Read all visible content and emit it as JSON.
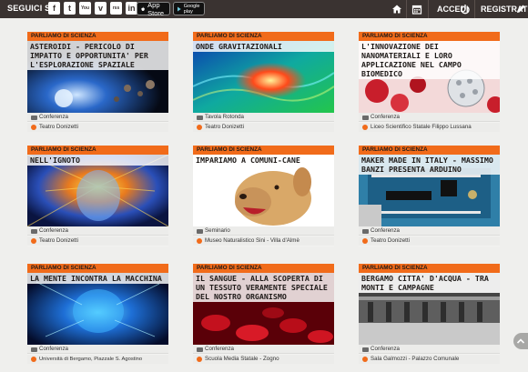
{
  "header": {
    "follow_label": "SEGUICI SU",
    "social": [
      "f",
      "t",
      "You",
      "v",
      "rss",
      "in"
    ],
    "app_store": "App Store",
    "google_play": "Google play",
    "login": "ACCEDI",
    "register": "REGISTRATI"
  },
  "cards": [
    {
      "tag": "PARLIAMO DI SCIENZA",
      "title": "ASTEROIDI - PERICOLO DI IMPATTO E OPPORTUNITA' PER L'ESPLORAZIONE SPAZIALE",
      "type": "Conferenza",
      "place": "Teatro Donizetti"
    },
    {
      "tag": "PARLIAMO DI SCIENZA",
      "title": "ONDE GRAVITAZIONALI",
      "type": "Tavola Rotonda",
      "place": "Teatro Donizetti"
    },
    {
      "tag": "PARLIAMO DI SCIENZA",
      "title": "L'INNOVAZIONE DEI NANOMATERIALI E LORO APPLICAZIONE NEL CAMPO BIOMEDICO",
      "type": "Conferenza",
      "place": "Liceo Scientifico Statale Filippo Lussana"
    },
    {
      "tag": "PARLIAMO DI SCIENZA",
      "title": "NELL'IGNOTO",
      "type": "Conferenza",
      "place": "Teatro Donizetti"
    },
    {
      "tag": "PARLIAMO DI SCIENZA",
      "title": "IMPARIAMO A COMUNI-CANE",
      "type": "Seminario",
      "place": "Museo Naturalistico Sini - Villa d'Almè"
    },
    {
      "tag": "PARLIAMO DI SCIENZA",
      "title": "MAKER MADE IN ITALY - MASSIMO BANZI PRESENTA ARDUINO",
      "type": "Conferenza",
      "place": "Teatro Donizetti"
    },
    {
      "tag": "PARLIAMO DI SCIENZA",
      "title": "LA MENTE INCONTRA LA MACCHINA",
      "type": "Conferenza",
      "place": "Università di Bergamo, Piazzale S. Agostino"
    },
    {
      "tag": "PARLIAMO DI SCIENZA",
      "title": "IL SANGUE - ALLA SCOPERTA DI UN TESSUTO VERAMENTE SPECIALE DEL NOSTRO ORGANISMO",
      "type": "Conferenza",
      "place": "Scuola Media Statale - Zogno"
    },
    {
      "tag": "PARLIAMO DI SCIENZA",
      "title": "BERGAMO CITTA' D'ACQUA - TRA MONTI E CAMPAGNE",
      "type": "Conferenza",
      "place": "Sala Galmozzi - Palazzo Comunale"
    }
  ]
}
